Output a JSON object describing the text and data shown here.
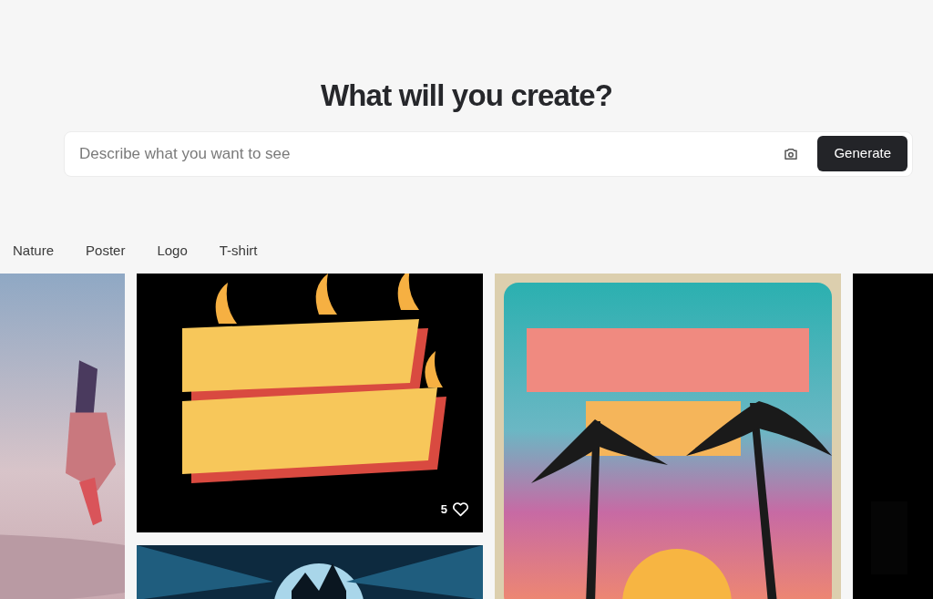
{
  "heading": "What will you create?",
  "prompt": {
    "placeholder": "Describe what you want to see",
    "button": "Generate"
  },
  "categories": [
    "Nature",
    "Poster",
    "Logo",
    "T-shirt"
  ],
  "gallery": [
    {
      "tiles": [
        {
          "kind": "picture"
        }
      ]
    },
    {
      "tiles": [
        {
          "kind": "picture",
          "likes": "5"
        },
        {
          "kind": "picture"
        }
      ]
    },
    {
      "tiles": [
        {
          "kind": "picture"
        }
      ]
    },
    {
      "tiles": [
        {
          "kind": "picture"
        }
      ]
    }
  ]
}
